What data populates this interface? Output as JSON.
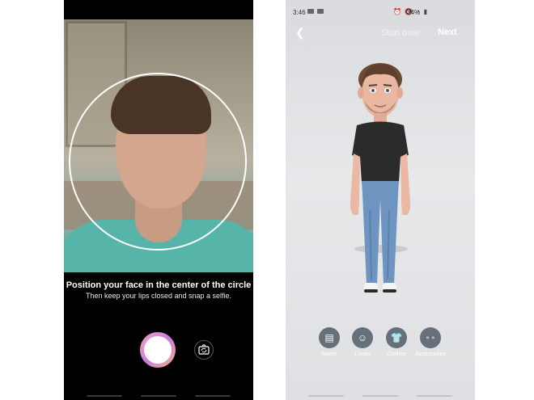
{
  "selfie_screen": {
    "instruction_title": "Position your face in the center of the circle",
    "instruction_sub": "Then keep your lips closed and snap a selfie."
  },
  "editor_screen": {
    "status_bar": {
      "time": "3:46",
      "battery": "74%"
    },
    "top_bar": {
      "back_icon": "chevron-left-icon",
      "start_over": "Start over",
      "next": "Next"
    },
    "tools": [
      {
        "label": "Name",
        "icon": "id-card-icon"
      },
      {
        "label": "Looks",
        "icon": "face-icon"
      },
      {
        "label": "Clothes",
        "icon": "shirt-icon"
      },
      {
        "label": "Accessories",
        "icon": "glasses-icon"
      }
    ]
  }
}
